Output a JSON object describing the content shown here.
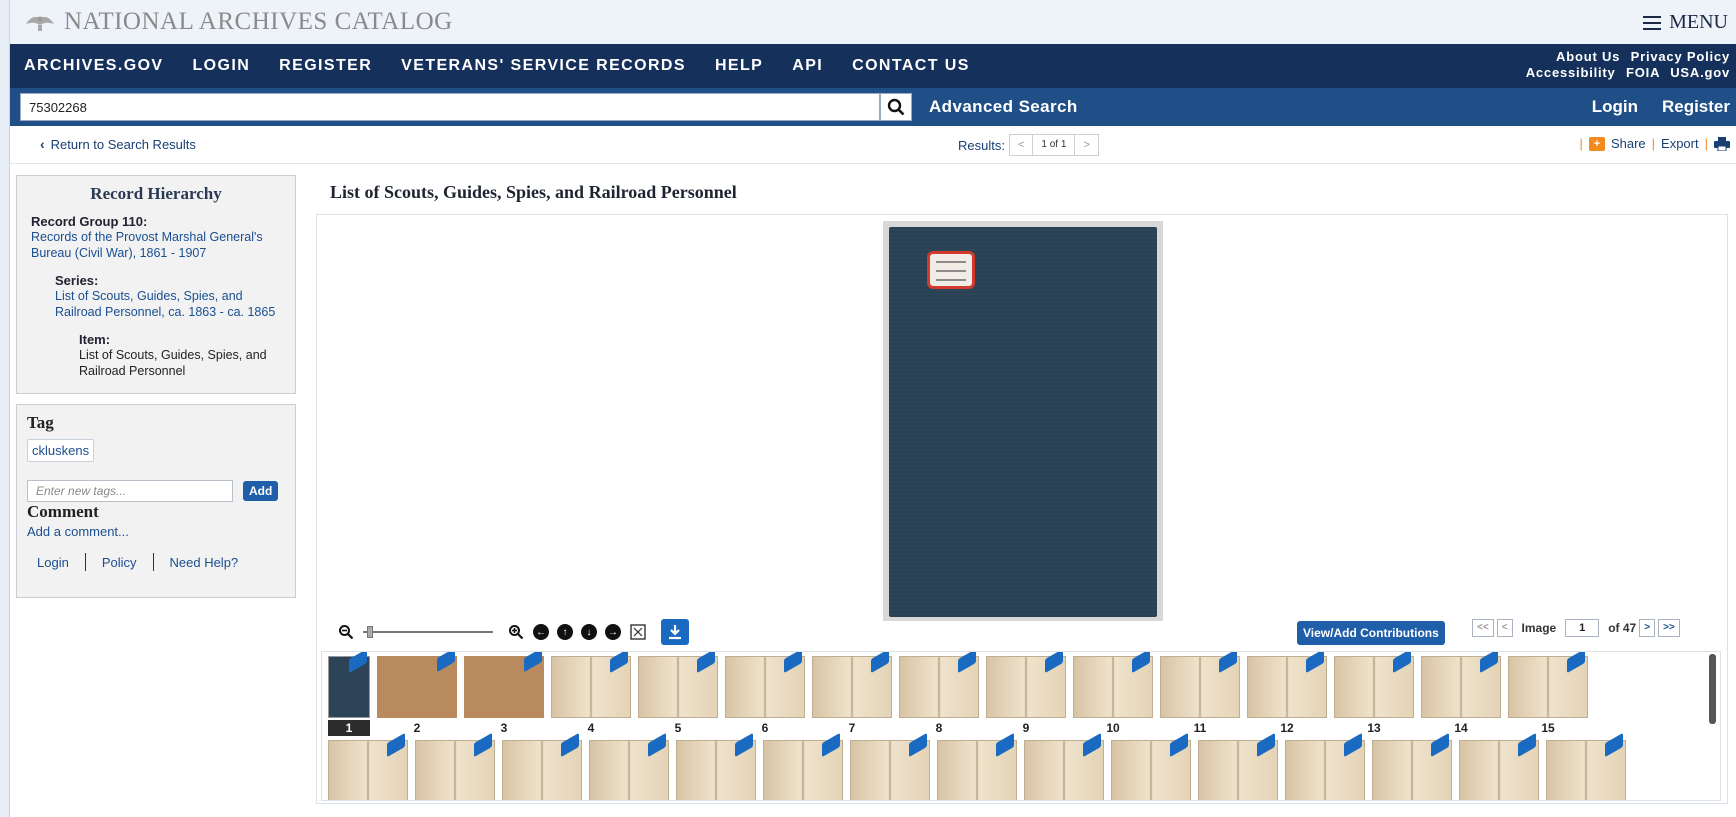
{
  "brand": {
    "title": "NATIONAL ARCHIVES CATALOG",
    "menu_label": "MENU"
  },
  "nav": {
    "links": [
      "ARCHIVES.GOV",
      "LOGIN",
      "REGISTER",
      "VETERANS' SERVICE RECORDS",
      "HELP",
      "API",
      "CONTACT US"
    ],
    "right_row1": [
      "About Us",
      "Privacy Policy"
    ],
    "right_row2": [
      "Accessibility",
      "FOIA",
      "USA.gov"
    ]
  },
  "search": {
    "value": "75302268",
    "advanced_label": "Advanced Search",
    "login_label": "Login",
    "register_label": "Register"
  },
  "results": {
    "return_label": "Return to Search Results",
    "results_label": "Results:",
    "prev": "<",
    "count": "1 of 1",
    "next": ">",
    "share_label": "Share",
    "export_label": "Export"
  },
  "hierarchy": {
    "title": "Record Hierarchy",
    "group_label": "Record Group 110:",
    "group_link": "Records of the Provost Marshal General's Bureau (Civil War), 1861 - 1907",
    "series_label": "Series:",
    "series_link": "List of Scouts, Guides, Spies, and Railroad Personnel, ca. 1863 - ca. 1865",
    "item_label": "Item:",
    "item_text": "List of Scouts, Guides, Spies, and Railroad Personnel"
  },
  "tags": {
    "title": "Tag",
    "chip": "ckluskens",
    "placeholder": "Enter new tags...",
    "add_label": "Add",
    "comment_title": "Comment",
    "comment_add": "Add a comment...",
    "links": [
      "Login",
      "Policy",
      "Need Help?"
    ]
  },
  "record": {
    "title": "List of Scouts, Guides, Spies, and Railroad Personnel",
    "contrib_label": "View/Add Contributions",
    "image_label": "Image",
    "image_current": "1",
    "image_total": "of 47",
    "first_btn": "<<",
    "prev_btn": "<",
    "next_btn": ">",
    "last_btn": ">>",
    "zoom_level_percent": 0,
    "thumbnail_numbers": [
      "1",
      "2",
      "3",
      "4",
      "5",
      "6",
      "7",
      "8",
      "9",
      "10",
      "11",
      "12",
      "13",
      "14",
      "15"
    ]
  },
  "colors": {
    "nav_dark": "#15305a",
    "search_blue": "#1f4f86",
    "accent_blue": "#1f5ea8",
    "share_orange": "#f28a1e"
  }
}
